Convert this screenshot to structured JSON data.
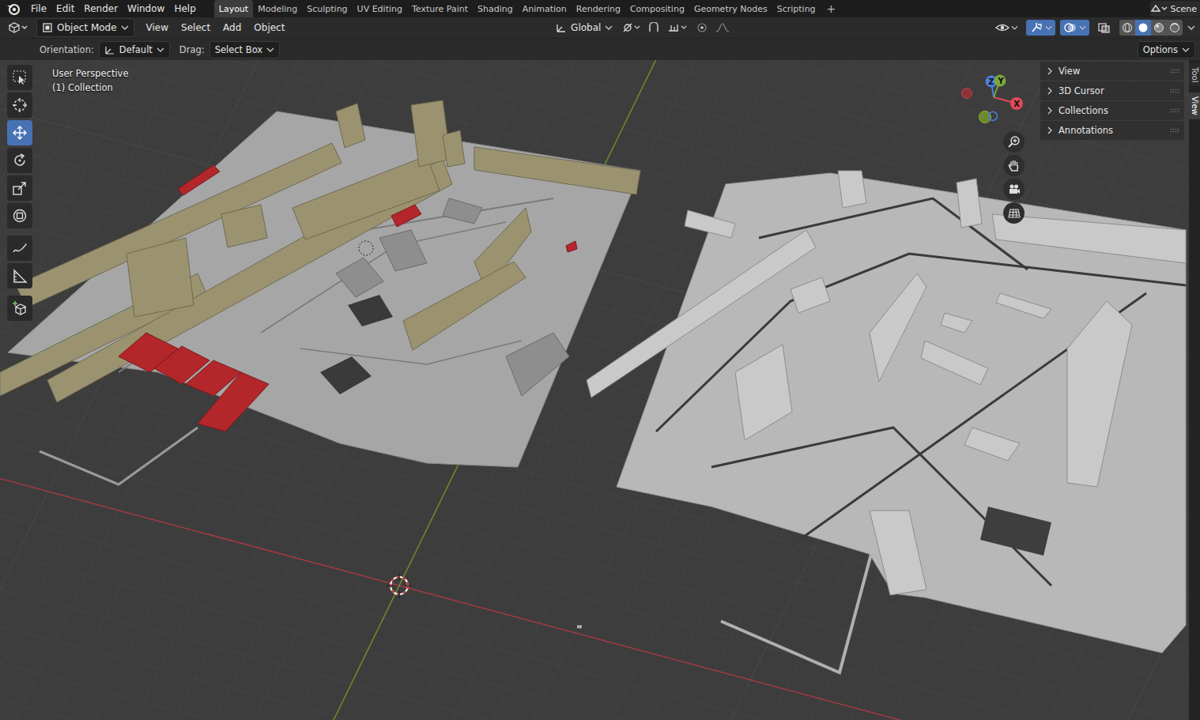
{
  "topbar": {
    "menus": [
      "File",
      "Edit",
      "Render",
      "Window",
      "Help"
    ],
    "workspaces": [
      {
        "label": "Layout",
        "selected": true
      },
      {
        "label": "Modeling",
        "selected": false
      },
      {
        "label": "Sculpting",
        "selected": false
      },
      {
        "label": "UV Editing",
        "selected": false
      },
      {
        "label": "Texture Paint",
        "selected": false
      },
      {
        "label": "Shading",
        "selected": false
      },
      {
        "label": "Animation",
        "selected": false
      },
      {
        "label": "Rendering",
        "selected": false
      },
      {
        "label": "Compositing",
        "selected": false
      },
      {
        "label": "Geometry Nodes",
        "selected": false
      },
      {
        "label": "Scripting",
        "selected": false
      }
    ],
    "add_tab": "+",
    "scene": "Scene"
  },
  "header": {
    "mode": "Object Mode",
    "menus": [
      "View",
      "Select",
      "Add",
      "Object"
    ],
    "orientation": "Global",
    "toggles": [
      {
        "kind": "visibility",
        "on": false
      },
      {
        "kind": "gizmo",
        "on": true
      },
      {
        "kind": "overlay",
        "on": true
      },
      {
        "kind": "xray",
        "on": false
      }
    ],
    "shading": [
      {
        "kind": "wireframe",
        "selected": false
      },
      {
        "kind": "solid",
        "selected": true
      },
      {
        "kind": "material",
        "selected": false
      },
      {
        "kind": "rendered",
        "selected": false
      }
    ]
  },
  "tool_settings": {
    "orientation_label": "Orientation:",
    "orientation": "Default",
    "drag_label": "Drag:",
    "drag": "Select Box",
    "options": "Options"
  },
  "toolbar": [
    {
      "kind": "select",
      "selected": false
    },
    {
      "kind": "cursor",
      "selected": false
    },
    {
      "kind": "move",
      "selected": true
    },
    {
      "kind": "rotate",
      "selected": false
    },
    {
      "kind": "scale",
      "selected": false
    },
    {
      "kind": "transform",
      "selected": false
    },
    {
      "kind": "annotate",
      "selected": false
    },
    {
      "kind": "measure",
      "selected": false
    },
    {
      "kind": "add-cube",
      "selected": false
    }
  ],
  "viewport": {
    "view_name": "User Perspective",
    "collection": "(1) Collection",
    "gizmo_axes": [
      "Z",
      "Y",
      "X"
    ]
  },
  "sidebar": {
    "panels": [
      {
        "label": "View",
        "expanded": false
      },
      {
        "label": "3D Cursor",
        "expanded": false
      },
      {
        "label": "Collections",
        "expanded": false
      },
      {
        "label": "Annotations",
        "expanded": false
      }
    ],
    "tabs": [
      {
        "label": "Tool",
        "selected": false
      },
      {
        "label": "View",
        "selected": true
      }
    ]
  }
}
